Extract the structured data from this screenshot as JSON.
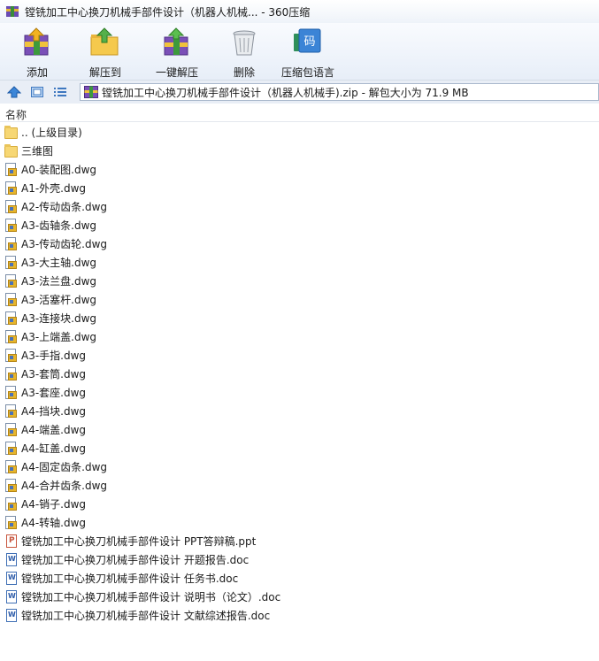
{
  "window": {
    "title": "镗铣加工中心换刀机械手部件设计（机器人机械... - 360压缩"
  },
  "toolbar": [
    {
      "label": "添加",
      "icon": "add-archive-icon"
    },
    {
      "label": "解压到",
      "icon": "extract-to-icon"
    },
    {
      "label": "一键解压",
      "icon": "one-click-extract-icon"
    },
    {
      "label": "删除",
      "icon": "delete-trash-icon"
    },
    {
      "label": "压缩包语言",
      "icon": "archive-language-icon",
      "icon_text": "码"
    }
  ],
  "addressbar": {
    "path": "镗铣加工中心换刀机械手部件设计（机器人机械手).zip - 解包大小为 71.9 MB"
  },
  "columns": {
    "name": "名称"
  },
  "files": [
    {
      "name": ".. (上级目录)",
      "type": "folder"
    },
    {
      "name": "三维图",
      "type": "folder"
    },
    {
      "name": "A0-装配图.dwg",
      "type": "dwg"
    },
    {
      "name": "A1-外壳.dwg",
      "type": "dwg"
    },
    {
      "name": "A2-传动齿条.dwg",
      "type": "dwg"
    },
    {
      "name": "A3-齿轴条.dwg",
      "type": "dwg"
    },
    {
      "name": "A3-传动齿轮.dwg",
      "type": "dwg"
    },
    {
      "name": "A3-大主轴.dwg",
      "type": "dwg"
    },
    {
      "name": "A3-法兰盘.dwg",
      "type": "dwg"
    },
    {
      "name": "A3-活塞杆.dwg",
      "type": "dwg"
    },
    {
      "name": "A3-连接块.dwg",
      "type": "dwg"
    },
    {
      "name": "A3-上端盖.dwg",
      "type": "dwg"
    },
    {
      "name": "A3-手指.dwg",
      "type": "dwg"
    },
    {
      "name": "A3-套筒.dwg",
      "type": "dwg"
    },
    {
      "name": "A3-套座.dwg",
      "type": "dwg"
    },
    {
      "name": "A4-挡块.dwg",
      "type": "dwg"
    },
    {
      "name": "A4-端盖.dwg",
      "type": "dwg"
    },
    {
      "name": "A4-缸盖.dwg",
      "type": "dwg"
    },
    {
      "name": "A4-固定齿条.dwg",
      "type": "dwg"
    },
    {
      "name": "A4-合并齿条.dwg",
      "type": "dwg"
    },
    {
      "name": "A4-销子.dwg",
      "type": "dwg"
    },
    {
      "name": "A4-转轴.dwg",
      "type": "dwg"
    },
    {
      "name": "镗铣加工中心换刀机械手部件设计 PPT答辩稿.ppt",
      "type": "ppt"
    },
    {
      "name": "镗铣加工中心换刀机械手部件设计 开题报告.doc",
      "type": "doc"
    },
    {
      "name": "镗铣加工中心换刀机械手部件设计 任务书.doc",
      "type": "doc"
    },
    {
      "name": "镗铣加工中心换刀机械手部件设计 说明书（论文）.doc",
      "type": "doc"
    },
    {
      "name": "镗铣加工中心换刀机械手部件设计 文献综述报告.doc",
      "type": "doc"
    }
  ]
}
